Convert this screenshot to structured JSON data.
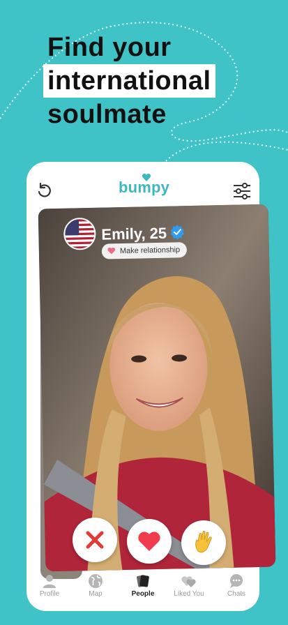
{
  "promo": {
    "line1": "Find your",
    "line2": "international",
    "line3": "soulmate"
  },
  "header": {
    "logo": "bumpy"
  },
  "profile": {
    "name": "Emily, 25",
    "badge": "Make relationship",
    "flag": "us-flag",
    "back_flag": "uk-flag"
  },
  "tabs": [
    {
      "label": "Profile",
      "icon": "profile-icon"
    },
    {
      "label": "Map",
      "icon": "globe-icon"
    },
    {
      "label": "People",
      "icon": "cards-icon"
    },
    {
      "label": "Liked You",
      "icon": "hearts-icon"
    },
    {
      "label": "Chats",
      "icon": "chat-icon"
    }
  ],
  "colors": {
    "background": "#3fc3c6",
    "brand": "#3fb7c0",
    "nope": "#e53935",
    "like": "#ef3b4b",
    "wave": "#f6c13b"
  }
}
